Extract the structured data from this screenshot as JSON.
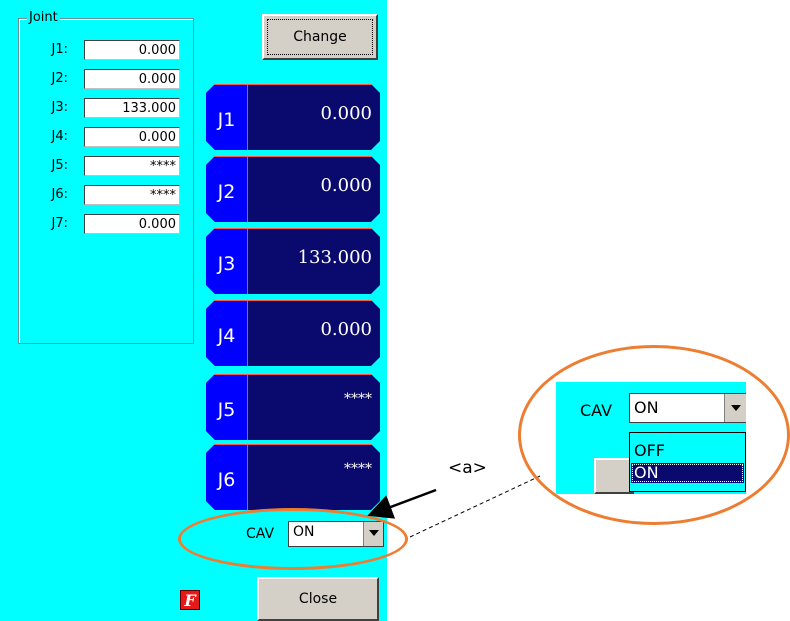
{
  "joint_group": {
    "title": "Joint",
    "rows": [
      {
        "label": "J1:",
        "value": "0.000"
      },
      {
        "label": "J2:",
        "value": "0.000"
      },
      {
        "label": "J3:",
        "value": "133.000"
      },
      {
        "label": "J4:",
        "value": "0.000"
      },
      {
        "label": "J5:",
        "value": "****"
      },
      {
        "label": "J6:",
        "value": "****"
      },
      {
        "label": "J7:",
        "value": "0.000"
      }
    ]
  },
  "change_button": {
    "label": "Change"
  },
  "joint_buttons": [
    {
      "tag": "J1",
      "value": "0.000"
    },
    {
      "tag": "J2",
      "value": "0.000"
    },
    {
      "tag": "J3",
      "value": "133.000"
    },
    {
      "tag": "J4",
      "value": "0.000"
    },
    {
      "tag": "J5",
      "value": "****"
    },
    {
      "tag": "J6",
      "value": "****"
    }
  ],
  "cav": {
    "label": "CAV",
    "selected": "ON",
    "options": [
      "OFF",
      "ON"
    ]
  },
  "close_button": {
    "label": "Close"
  },
  "f_icon": {
    "glyph": "F"
  },
  "callout": {
    "label": "<a>"
  },
  "colors": {
    "panel_bg": "#00ffff",
    "joint_button_bg": "#0a0a6e",
    "joint_tag_bg": "#0000ff",
    "callout_ring": "#ed7d31"
  }
}
